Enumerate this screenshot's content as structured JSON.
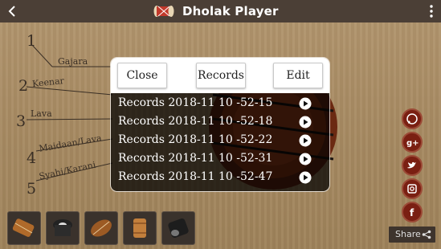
{
  "app": {
    "title": "Dholak Player"
  },
  "icons": {
    "back": "back-arrow-icon",
    "menu": "overflow-menu-icon",
    "logo": "dholak-logo-icon",
    "play": "play-circle-icon",
    "share": "share-icon"
  },
  "parts": [
    {
      "number": "1",
      "label": "Gajara"
    },
    {
      "number": "2",
      "label": "Keenar"
    },
    {
      "number": "3",
      "label": "Lava"
    },
    {
      "number": "4",
      "label": "Maidaan/Lava"
    },
    {
      "number": "5",
      "label": "Syahi/Karani"
    }
  ],
  "dialog": {
    "close_label": "Close",
    "records_label": "Records",
    "edit_label": "Edit",
    "records": [
      "Records 2018-11 10 -52-15",
      "Records 2018-11 10 -52-18",
      "Records 2018-11 10 -52-22",
      "Records 2018-11 10 -52-31",
      "Records 2018-11 10 -52-47"
    ]
  },
  "social": [
    "whatsapp-icon",
    "google-plus-icon",
    "twitter-icon",
    "instagram-icon",
    "facebook-icon"
  ],
  "share": {
    "label": "Share"
  },
  "instruments": [
    "instrument-1",
    "instrument-2",
    "instrument-3",
    "instrument-4",
    "instrument-5"
  ],
  "colors": {
    "topbar": "#4b3f36",
    "social": "#7a1f12",
    "wood": "#a88b63"
  }
}
